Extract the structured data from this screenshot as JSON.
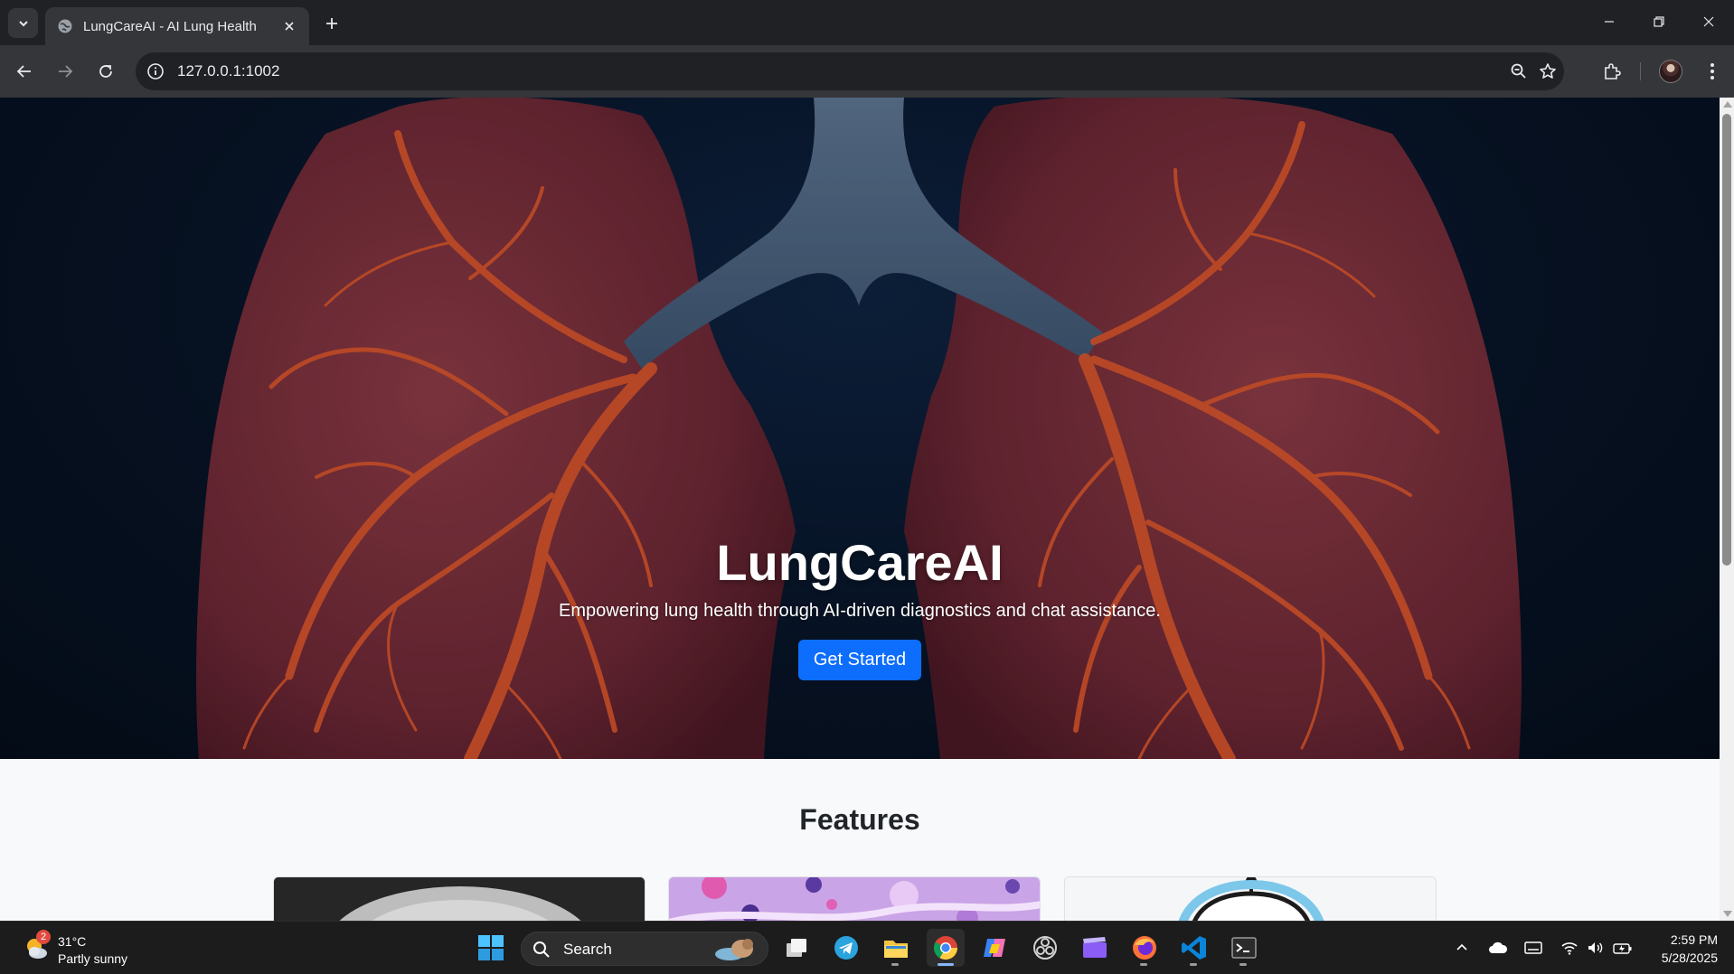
{
  "browser": {
    "tab_title": "LungCareAI - AI Lung Health",
    "url": "127.0.0.1:1002"
  },
  "hero": {
    "title": "LungCareAI",
    "subtitle": "Empowering lung health through AI-driven diagnostics and chat assistance.",
    "cta_label": "Get Started"
  },
  "features": {
    "heading": "Features"
  },
  "taskbar": {
    "weather_temp": "31°C",
    "weather_desc": "Partly sunny",
    "weather_badge": "2",
    "search_label": "Search",
    "time": "2:59 PM",
    "date": "5/28/2025"
  },
  "colors": {
    "accent": "#0d6efd",
    "hero_bg": "#071426",
    "lung": "#7a2f3a",
    "vessel": "#d9552b"
  }
}
